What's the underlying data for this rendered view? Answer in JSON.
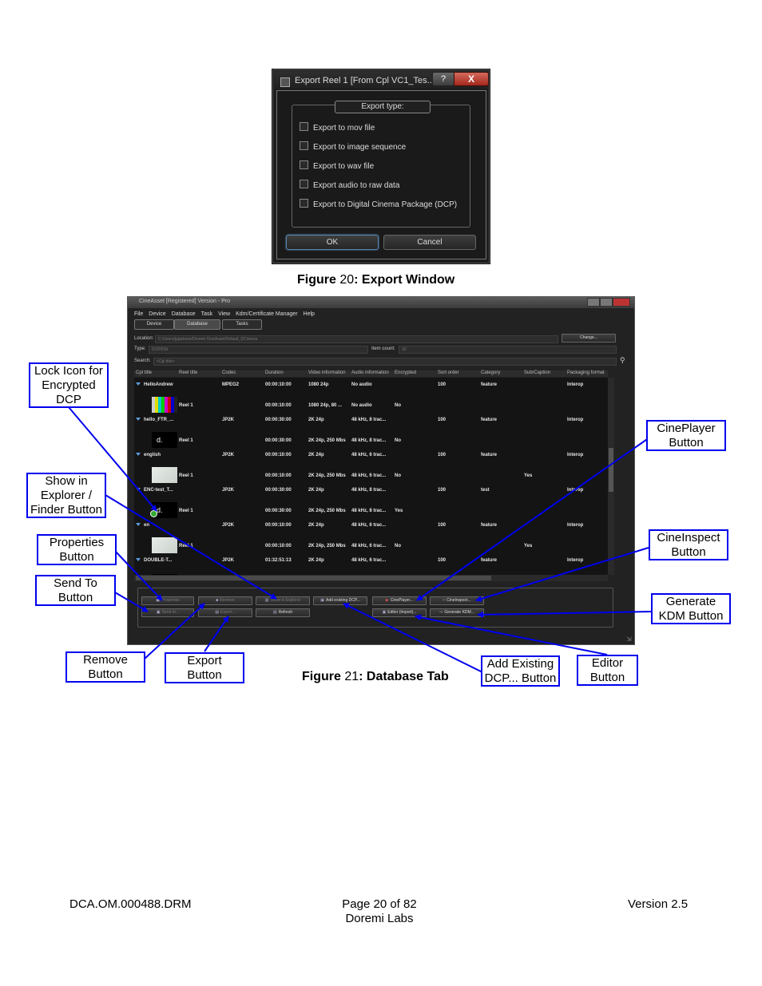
{
  "export_dialog": {
    "title": "Export Reel 1 [From Cpl VC1_Tes...",
    "help_label": "?",
    "close_label": "X",
    "group_title": "Export type:",
    "options": [
      "Export to mov file",
      "Export to image sequence",
      "Export to wav file",
      "Export audio to raw data",
      "Export to Digital Cinema Package (DCP)"
    ],
    "ok_label": "OK",
    "cancel_label": "Cancel"
  },
  "figure20": {
    "label": "Figure",
    "number": "20",
    "title": ": Export Window"
  },
  "figure21": {
    "label": "Figure",
    "number": "21",
    "title": ": Database Tab"
  },
  "database_window": {
    "title": "CineAsset [Registered] Version - Pro",
    "menu": [
      "File",
      "Device",
      "Database",
      "Task",
      "View",
      "Kdm/Certificate Manager",
      "Help"
    ],
    "tabs": [
      "Device",
      "Database",
      "Tasks"
    ],
    "location_label": "Location:",
    "location_value": "C:/Users/jpjackson/Doremi CineAsset/Default_DCinema",
    "change_label": "Change...",
    "type_label": "Type:",
    "type_value": "DCP/DSI",
    "item_count_label": "Item count:",
    "item_count_value": "10",
    "search_label": "Search:",
    "search_placeholder": "<Cpl title>",
    "columns": [
      "Cpl title",
      "Reel title",
      "Codec",
      "Duration",
      "Video information",
      "Audio information",
      "Encrypted",
      "Sort order",
      "Category",
      "Sub/Caption",
      "Packaging format"
    ],
    "rows": [
      {
        "kind": "cpl",
        "title": "HelloAndrew",
        "codec": "MPEG2",
        "duration": "00:00:10:00",
        "video": "1080 24p",
        "audio": "No audio",
        "encrypted": "",
        "sort": "100",
        "category": "feature",
        "sub": "",
        "packaging": "Interop"
      },
      {
        "kind": "reel",
        "title": "Reel 1",
        "duration": "00:00:10:00",
        "video": "1080 24p, 80 ...",
        "audio": "No audio",
        "encrypted": "No",
        "sub": "",
        "thumb": "bars"
      },
      {
        "kind": "cpl",
        "title": "hello_FTR_...",
        "codec": "JP2K",
        "duration": "00:00:30:00",
        "video": "2K 24p",
        "audio": "48 kHz, 8 trac...",
        "encrypted": "",
        "sort": "100",
        "category": "feature",
        "sub": "",
        "packaging": "Interop"
      },
      {
        "kind": "reel",
        "title": "Reel 1",
        "duration": "00:00:30:00",
        "video": "2K 24p, 250 Mbs",
        "audio": "48 kHz, 8 trac...",
        "encrypted": "No",
        "sub": "",
        "thumb": "doremi"
      },
      {
        "kind": "cpl",
        "title": "english",
        "codec": "JP2K",
        "duration": "00:00:10:00",
        "video": "2K 24p",
        "audio": "48 kHz, 6 trac...",
        "encrypted": "",
        "sort": "100",
        "category": "feature",
        "sub": "",
        "packaging": "Interop"
      },
      {
        "kind": "reel",
        "title": "Reel 1",
        "duration": "00:00:10:00",
        "video": "2K 24p, 250 Mbs",
        "audio": "48 kHz, 6 trac...",
        "encrypted": "No",
        "sub": "Yes",
        "thumb": "light"
      },
      {
        "kind": "cpl",
        "title": "ENC-test_T...",
        "codec": "JP2K",
        "duration": "00:00:30:00",
        "video": "2K 24p",
        "audio": "48 kHz, 8 trac...",
        "encrypted": "",
        "sort": "100",
        "category": "test",
        "sub": "",
        "packaging": "Interop"
      },
      {
        "kind": "reel",
        "title": "Reel 1",
        "duration": "00:00:30:00",
        "video": "2K 24p, 250 Mbs",
        "audio": "48 kHz, 8 trac...",
        "encrypted": "Yes",
        "sub": "",
        "thumb": "doremi-lock"
      },
      {
        "kind": "cpl",
        "title": "en",
        "codec": "JP2K",
        "duration": "00:00:10:00",
        "video": "2K 24p",
        "audio": "48 kHz, 6 trac...",
        "encrypted": "",
        "sort": "100",
        "category": "feature",
        "sub": "",
        "packaging": "Interop"
      },
      {
        "kind": "reel",
        "title": "Reel 1",
        "duration": "00:00:10:00",
        "video": "2K 24p, 250 Mbs",
        "audio": "48 kHz, 6 trac...",
        "encrypted": "No",
        "sub": "Yes",
        "thumb": "light"
      },
      {
        "kind": "cpl",
        "title": "DOUBLE-T...",
        "codec": "JP2K",
        "duration": "01:32:51:13",
        "video": "2K 24p",
        "audio": "48 kHz, 6 trac...",
        "encrypted": "",
        "sort": "100",
        "category": "feature",
        "sub": "",
        "packaging": "Interop"
      },
      {
        "kind": "reel",
        "title": "",
        "duration": "",
        "video": "",
        "audio": "",
        "encrypted": "",
        "sub": "",
        "thumb": "dark"
      }
    ],
    "buttons": {
      "properties": "Properties",
      "remove": "Remove",
      "show_in_explorer": "Show in Explorer",
      "add_existing_dcp": "Add existing DCP...",
      "cineplayer": "CinePlayer...",
      "cineinspect": "CineInspect...",
      "send_to": "Send to...",
      "export": "Export...",
      "refresh": "Refresh",
      "editor": "Editor (Import)...",
      "generate_kdm": "Generate KDM..."
    }
  },
  "callouts": {
    "lock_icon": "Lock Icon for\nEncrypted\nDCP",
    "show_in_explorer": "Show in\nExplorer /\nFinder Button",
    "properties": "Properties\nButton",
    "send_to": "Send To\nButton",
    "remove": "Remove\nButton",
    "export": "Export\nButton",
    "add_existing": "Add Existing\nDCP... Button",
    "editor": "Editor\nButton",
    "cineplayer": "CinePlayer\nButton",
    "cineinspect": "CineInspect\nButton",
    "generate_kdm": "Generate\nKDM Button"
  },
  "footer": {
    "doc_id": "DCA.OM.000488.DRM",
    "page": "Page 20 of 82",
    "company": "Doremi Labs",
    "version": "Version 2.5"
  },
  "colors": {
    "callout_border": "#0000ee",
    "arrow": "#0000ee",
    "ui_dark": "#1d1d1d"
  }
}
